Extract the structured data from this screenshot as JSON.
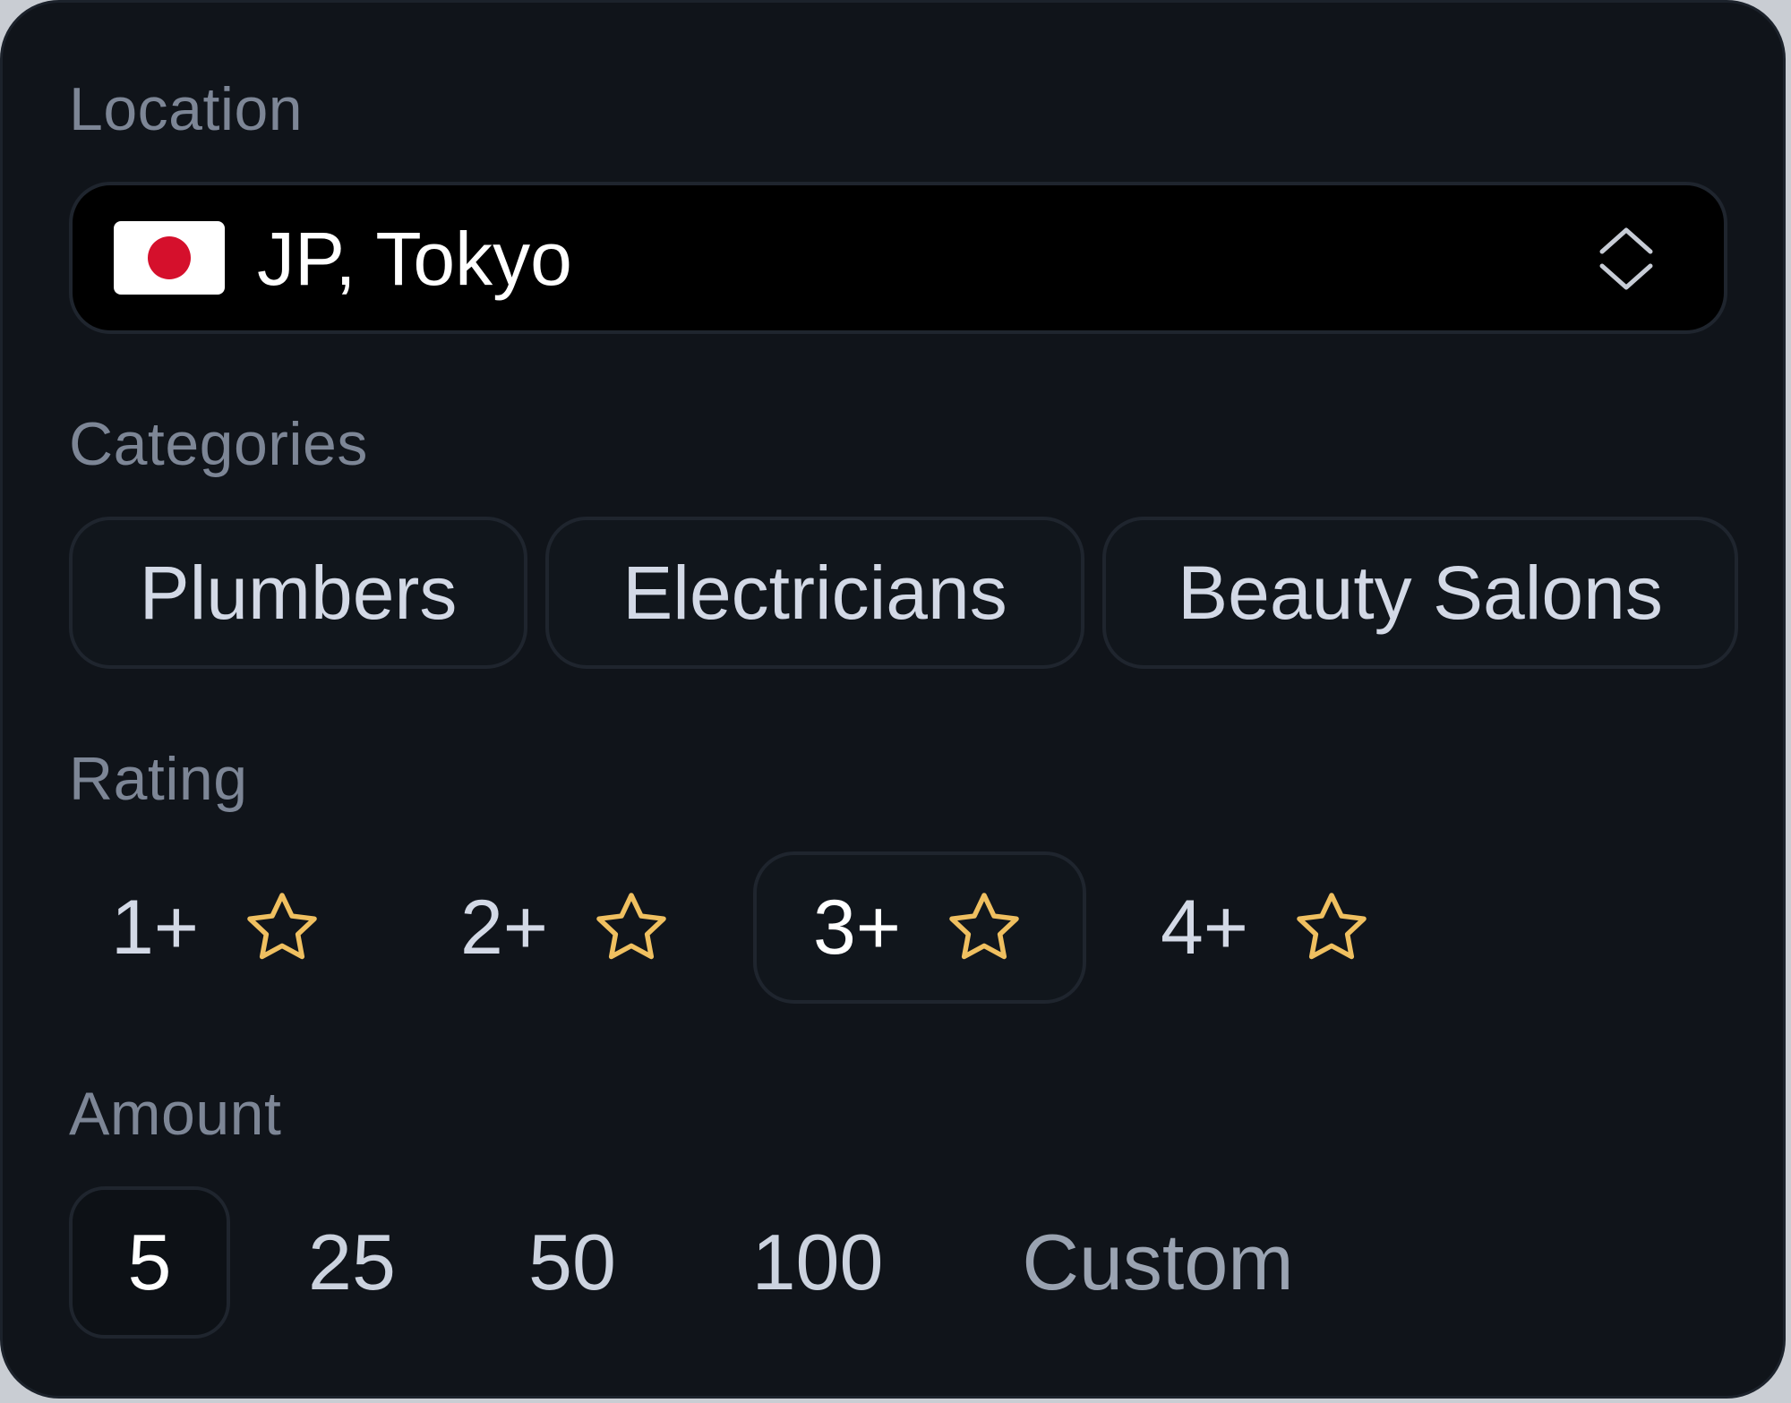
{
  "location": {
    "label": "Location",
    "selected_value": "JP, Tokyo",
    "flag_icon": "japan-flag-icon",
    "flag_colors": {
      "background": "#ffffff",
      "sun": "#d5102c"
    },
    "toggle_icon": "chevron-up-down-icon"
  },
  "categories": {
    "label": "Categories",
    "items": [
      "Plumbers",
      "Electricians",
      "Beauty Salons"
    ]
  },
  "rating": {
    "label": "Rating",
    "options": [
      {
        "label": "1+",
        "icon": "star-outline-icon",
        "selected": false
      },
      {
        "label": "2+",
        "icon": "star-outline-icon",
        "selected": false
      },
      {
        "label": "3+",
        "icon": "star-outline-icon",
        "selected": true
      },
      {
        "label": "4+",
        "icon": "star-outline-icon",
        "selected": false
      }
    ],
    "star_color": "#f0c060"
  },
  "amount": {
    "label": "Amount",
    "options": [
      "5",
      "25",
      "50",
      "100",
      "Custom"
    ],
    "selected": "5"
  }
}
